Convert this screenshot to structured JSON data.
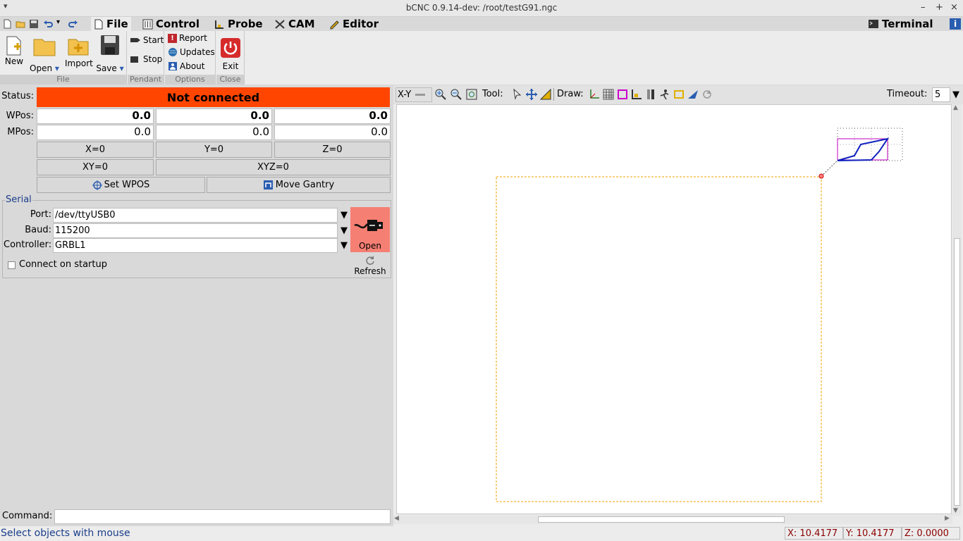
{
  "window": {
    "title": "bCNC 0.9.14-dev: /root/testG91.ngc"
  },
  "tabs": [
    {
      "label": "File",
      "icon": "document-icon"
    },
    {
      "label": "Control",
      "icon": "control-icon"
    },
    {
      "label": "Probe",
      "icon": "probe-icon"
    },
    {
      "label": "CAM",
      "icon": "cam-icon"
    },
    {
      "label": "Editor",
      "icon": "editor-icon"
    }
  ],
  "terminal_tab": {
    "label": "Terminal"
  },
  "ribbon": {
    "file": {
      "new": "New",
      "open": "Open",
      "import": "Import",
      "save": "Save",
      "group": "File"
    },
    "pendant": {
      "start": "Start",
      "stop": "Stop",
      "group": "Pendant"
    },
    "options": {
      "report": "Report",
      "updates": "Updates",
      "about": "About",
      "group": "Options"
    },
    "close": {
      "exit": "Exit",
      "group": "Close"
    }
  },
  "state": {
    "status_label": "Status:",
    "status_text": "Not connected",
    "status_color": "#ff4500"
  },
  "position": {
    "wpos_label": "WPos:",
    "mpos_label": "MPos:",
    "wpos": [
      "0.0",
      "0.0",
      "0.0"
    ],
    "mpos": [
      "0.0",
      "0.0",
      "0.0"
    ]
  },
  "buttons": {
    "x0": "X=0",
    "y0": "Y=0",
    "z0": "Z=0",
    "xy0": "XY=0",
    "xyz0": "XYZ=0",
    "set_wpos": "Set WPOS",
    "move_gantry": "Move Gantry"
  },
  "serial": {
    "legend": "Serial",
    "port_label": "Port:",
    "port_value": "/dev/ttyUSB0",
    "baud_label": "Baud:",
    "baud_value": "115200",
    "controller_label": "Controller:",
    "controller_value": "GRBL1",
    "open_label": "Open",
    "refresh_label": "Refresh",
    "connect_startup": "Connect on startup"
  },
  "command": {
    "label": "Command:",
    "value": ""
  },
  "canvas_toolbar": {
    "view": "X-Y",
    "tool_label": "Tool:",
    "draw_label": "Draw:",
    "timeout_label": "Timeout:",
    "timeout_value": "5"
  },
  "statusbar": {
    "message": "Select objects with mouse",
    "x": "X: 10.4177",
    "y": "Y: 10.4177",
    "z": "Z: 0.0000"
  }
}
